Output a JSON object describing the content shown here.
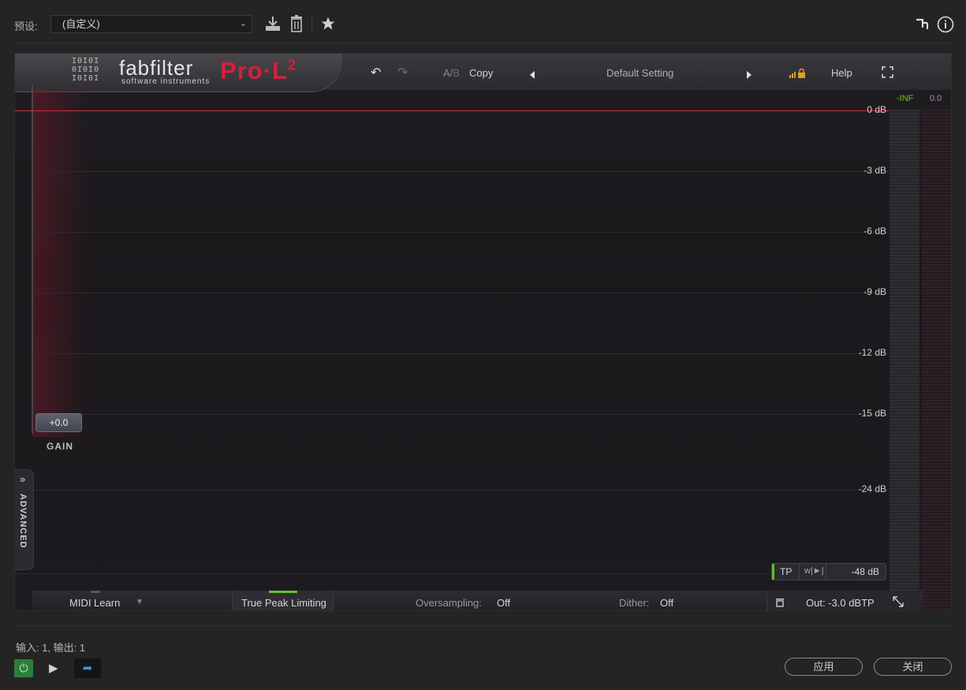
{
  "toolbar": {
    "preset_label": "预设:",
    "preset_value": "(自定义)",
    "icons": [
      "download-icon",
      "trash-icon",
      "star-icon",
      "routing-icon",
      "info-icon"
    ]
  },
  "plugin": {
    "brand": "fabfilter",
    "brand_sub": "software instruments",
    "product": "Pro·L",
    "product_sup": "2",
    "ab_label": "A/",
    "ab_dim": "B",
    "copy_label": "Copy",
    "preset_name": "Default Setting",
    "help_label": "Help",
    "db_labels": [
      "0 dB",
      "-3 dB",
      "-6 dB",
      "-9 dB",
      "-12 dB",
      "-15 dB",
      "-24 dB"
    ],
    "meter_in": "-INF",
    "meter_out": "0.0",
    "gain_value": "+0.0",
    "gain_label": "GAIN",
    "advanced_label": "ADVANCED",
    "tp_label": "TP",
    "range_value": "-48 dB",
    "midi_learn": "MIDI Learn",
    "true_peak": "True Peak Limiting",
    "oversampling_label": "Oversampling:",
    "oversampling_value": "Off",
    "dither_label": "Dither:",
    "dither_value": "Off",
    "out_value": "Out: -3.0 dBTP"
  },
  "footer": {
    "io_text": "输入: 1, 输出: 1",
    "apply_label": "应用",
    "close_label": "关闭"
  },
  "colors": {
    "accent_red": "#c23040",
    "led_green": "#62c22f",
    "route_blue": "#2f9bf5"
  }
}
